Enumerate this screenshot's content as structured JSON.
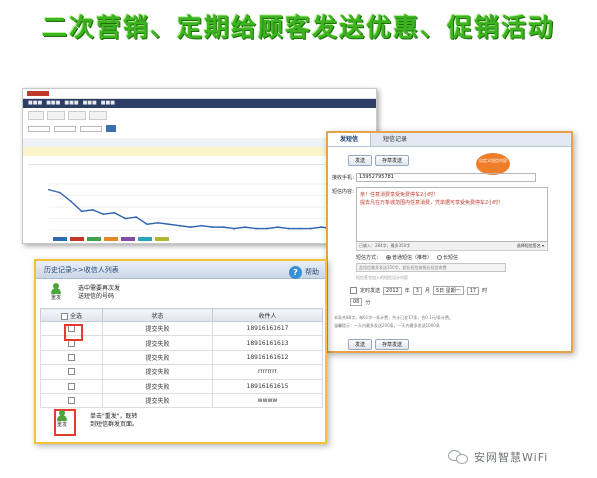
{
  "banner": {
    "title": "二次营销、定期给顾客发送优惠、促销活动"
  },
  "sms_window": {
    "tabs": [
      "发短信",
      "短信记录"
    ],
    "toolbar": [
      "发送",
      "存草发送"
    ],
    "recipient_label": "接收手机：",
    "recipient_value": "13952795781",
    "content_label": "短信内容：",
    "message_line1": "亲！任意消费享受免费停车2小时！",
    "message_line2": "提去凡在万象城范围内任意消费，凭单据可享受免费停车2小时！",
    "counter": "已输入：284字，最多350字",
    "signature_button": "选择短信签名",
    "bubble_text": "自定义短信内容",
    "type_label": "短信方式：",
    "type_options": [
      "普通短信（推荐）",
      "长短信"
    ],
    "sign_placeholder": "此短信最多发送350字，超长短信按照长短信收费",
    "sign_note": "短信签名加入的短信设计内容",
    "schedule_check": "定时发送",
    "schedule": {
      "year": "2012",
      "year_unit": "年",
      "month": "3",
      "month_unit": "月",
      "day": "5日 星期一",
      "hour": "17",
      "hour_unit": "时",
      "minute": "08",
      "minute_unit": "分"
    },
    "hint1": "本条共88字，每61字一条计费，共计已发17条，合0.1元/条计费。",
    "hint2": "温馨提示：一天内最多发送200条，一天内最多发送1000条",
    "bottom_buttons": [
      "发送",
      "存草发送"
    ]
  },
  "history_window": {
    "title": "历史记录>>收信人列表",
    "help_label": "帮助",
    "resend_label": "重发",
    "callout_top": "选中需要再次发\n送短信的号码",
    "callout_bottom": "单击\"重发\"，既转\n到短信群发页面。",
    "columns": [
      "全选",
      "状态",
      "收件人"
    ],
    "rows": [
      {
        "status": "提交失败",
        "recipient": "18916161617"
      },
      {
        "status": "提交失败",
        "recipient": "18916161613"
      },
      {
        "status": "提交失败",
        "recipient": "18916161612"
      },
      {
        "status": "提交失败",
        "recipient": "rrrrrrrr"
      },
      {
        "status": "提交失败",
        "recipient": "18916161615"
      },
      {
        "status": "提交失败",
        "recipient": "wwww"
      }
    ]
  },
  "watermark": {
    "text": "安网智慧WiFi"
  },
  "chart_data": {
    "type": "line",
    "title": "",
    "x": [
      0,
      1,
      2,
      3,
      4,
      5,
      6,
      7,
      8,
      9,
      10,
      11,
      12,
      13,
      14,
      15,
      16,
      17,
      18,
      19,
      20,
      21,
      22,
      23,
      24,
      25,
      26,
      27,
      28,
      29
    ],
    "series": [
      {
        "values": [
          28,
          26,
          20,
          13,
          14,
          11,
          12,
          8,
          9,
          4,
          5,
          4,
          3,
          2,
          3,
          2,
          2,
          1,
          2,
          1,
          1,
          2,
          1,
          1,
          1,
          2,
          1,
          1,
          1,
          1
        ]
      }
    ],
    "ylim": [
      0,
      32
    ],
    "grid": true,
    "legend_colors": [
      "#2d6bb5",
      "#c0392b",
      "#3fa34d",
      "#e28a2b",
      "#7d4ba0",
      "#2aa3b8",
      "#b5b534"
    ]
  }
}
